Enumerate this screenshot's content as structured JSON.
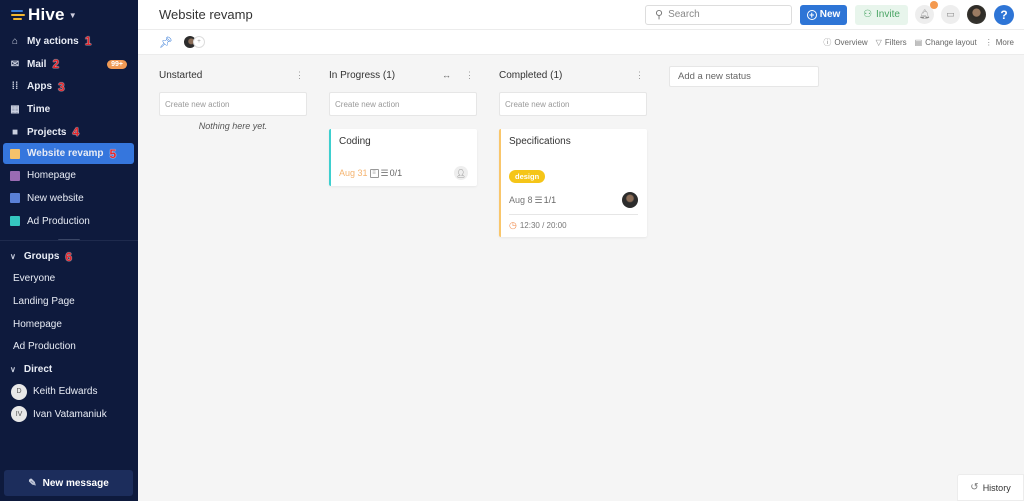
{
  "app": {
    "brand": "Hive"
  },
  "sidebar": {
    "nav": [
      {
        "label": "My actions",
        "icon": "home-icon",
        "marker": "1"
      },
      {
        "label": "Mail",
        "icon": "mail-icon",
        "marker": "2",
        "badge": "99+"
      },
      {
        "label": "Apps",
        "icon": "apps-grid-icon",
        "marker": "3"
      },
      {
        "label": "Time",
        "icon": "calendar-icon"
      },
      {
        "label": "Projects",
        "icon": "folder-icon",
        "marker": "4"
      }
    ],
    "projects": [
      {
        "label": "Website revamp",
        "color": "#f5c26b",
        "marker": "5",
        "active": true
      },
      {
        "label": "Homepage",
        "color": "#9a6bb3"
      },
      {
        "label": "New website",
        "color": "#5a80d6"
      },
      {
        "label": "Ad Production",
        "color": "#35c6c0"
      }
    ],
    "groups": {
      "label": "Groups",
      "marker": "6",
      "items": [
        "Everyone",
        "Landing Page",
        "Homepage",
        "Ad Production"
      ]
    },
    "direct": {
      "label": "Direct",
      "items": [
        {
          "initials": "D",
          "name": "Keith Edwards"
        },
        {
          "initials": "IV",
          "name": "Ivan Vatamaniuk"
        }
      ]
    },
    "new_message": "New message"
  },
  "header": {
    "title": "Website revamp",
    "search_placeholder": "Search",
    "new_label": "New",
    "invite_label": "Invite",
    "help_label": "?"
  },
  "subbar": {
    "overview": "Overview",
    "filters": "Filters",
    "change_layout": "Change layout",
    "more": "More"
  },
  "board": {
    "create_placeholder": "Create new action",
    "columns": [
      {
        "title": "Unstarted",
        "empty": "Nothing here yet."
      },
      {
        "title": "In Progress (1)",
        "accent": "#3ecfcf",
        "card": {
          "title": "Coding",
          "due": "Aug 31",
          "checklist": "0/1"
        }
      },
      {
        "title": "Completed (1)",
        "accent": "#f9c66b",
        "card": {
          "title": "Specifications",
          "tag": "design",
          "tag_color": "#f5c518",
          "due": "Aug 8",
          "checklist": "1/1",
          "time": "12:30  / 20:00"
        }
      }
    ],
    "add_status": "Add a new status"
  },
  "footer": {
    "history": "History"
  }
}
